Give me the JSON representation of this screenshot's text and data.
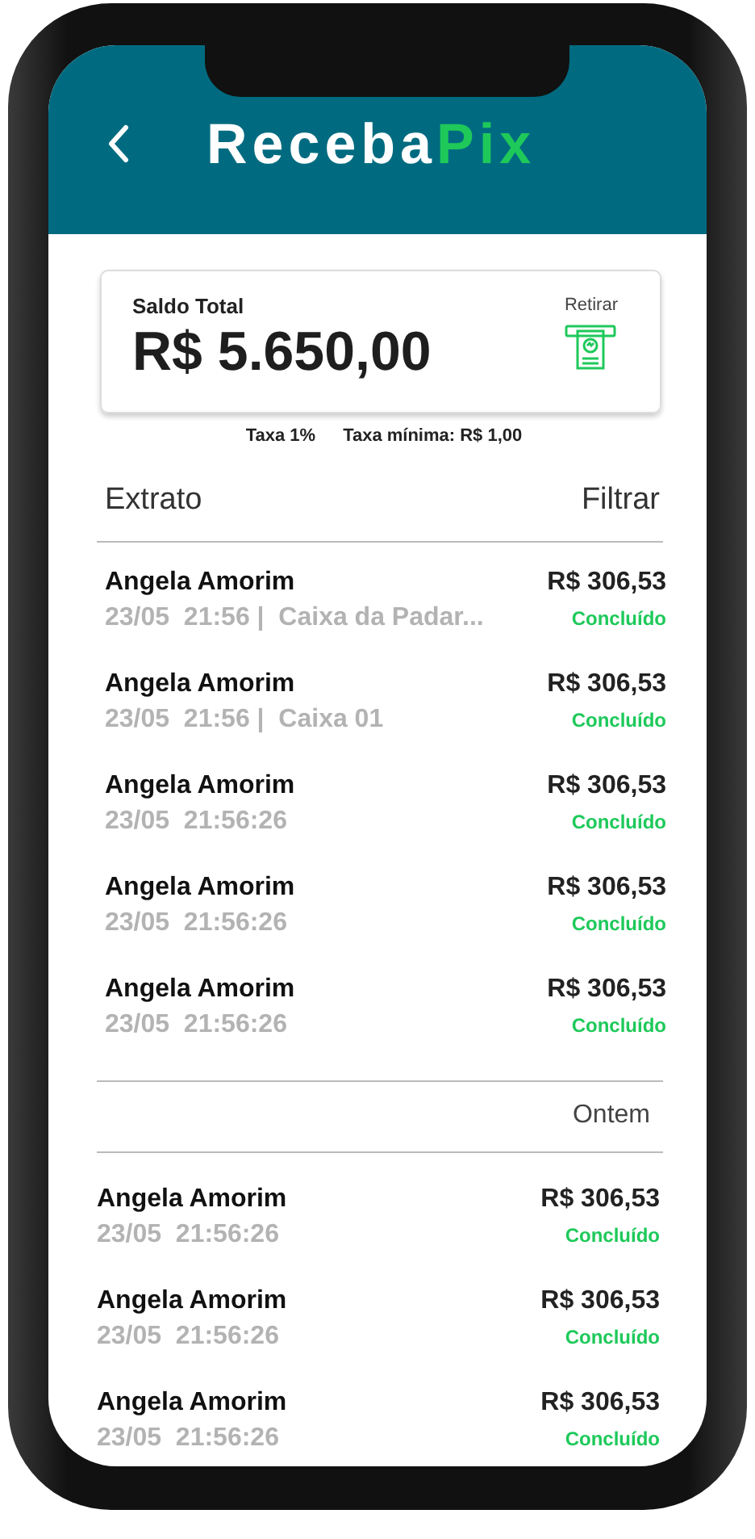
{
  "header": {
    "title_main": "Receba",
    "title_accent": "Pix"
  },
  "balance": {
    "label": "Saldo Total",
    "amount": "R$ 5.650,00",
    "action": "Retirar"
  },
  "fees": [
    "Taxa 1%",
    "Taxa mínima: R$ 1,00"
  ],
  "statement": {
    "title": "Extrato",
    "filter": "Filtrar"
  },
  "groups": [
    {
      "rows": [
        {
          "name": "Angela Amorim",
          "detail": "23/05  21:56 |  Caixa da Padar...",
          "amount": "R$ 306,53",
          "status": "Concluído"
        },
        {
          "name": "Angela Amorim",
          "detail": "23/05  21:56 |  Caixa 01",
          "amount": "R$ 306,53",
          "status": "Concluído"
        },
        {
          "name": "Angela Amorim",
          "detail": "23/05  21:56:26",
          "amount": "R$ 306,53",
          "status": "Concluído"
        },
        {
          "name": "Angela Amorim",
          "detail": "23/05  21:56:26",
          "amount": "R$ 306,53",
          "status": "Concluído"
        },
        {
          "name": "Angela Amorim",
          "detail": "23/05  21:56:26",
          "amount": "R$ 306,53",
          "status": "Concluído"
        }
      ]
    },
    {
      "heading": "Ontem",
      "rows": [
        {
          "name": "Angela Amorim",
          "detail": "23/05  21:56:26",
          "amount": "R$ 306,53",
          "status": "Concluído"
        },
        {
          "name": "Angela Amorim",
          "detail": "23/05  21:56:26",
          "amount": "R$ 306,53",
          "status": "Concluído"
        },
        {
          "name": "Angela Amorim",
          "detail": "23/05  21:56:26",
          "amount": "R$ 306,53",
          "status": "Concluído"
        }
      ]
    }
  ]
}
